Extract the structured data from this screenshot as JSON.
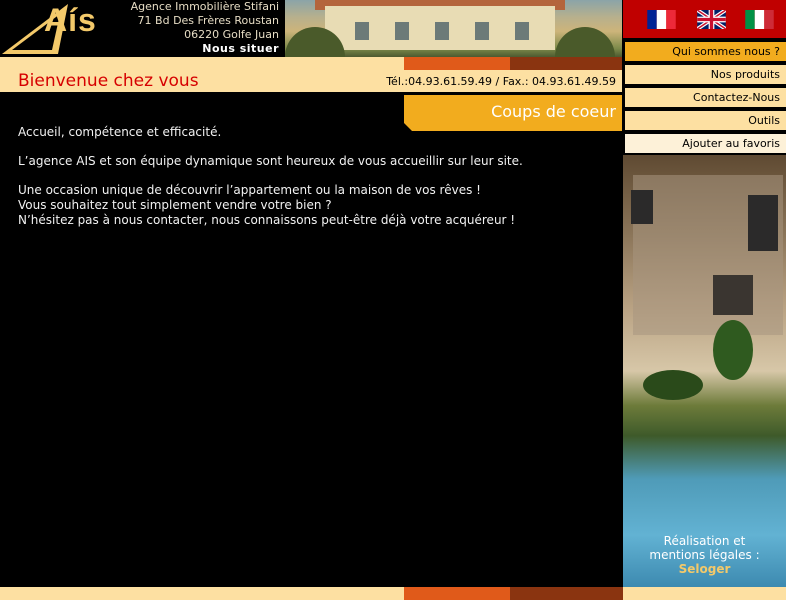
{
  "brand": {
    "logo_text": "Aís"
  },
  "address": {
    "line1": "Agence Immobilière Stifani",
    "line2": "71 Bd Des Frères Roustan",
    "line3": "06220 Golfe Juan",
    "locate_link": "Nous situer"
  },
  "header": {
    "title": "Bienvenue chez vous",
    "phone": "Tél.:04.93.61.59.49 / Fax.: 04.93.61.49.59",
    "tab_label": "Coups de coeur"
  },
  "languages": [
    {
      "name": "french-flag-icon"
    },
    {
      "name": "uk-flag-icon"
    },
    {
      "name": "italian-flag-icon"
    }
  ],
  "menu": {
    "items": [
      {
        "label": "Qui sommes nous ?"
      },
      {
        "label": "Nos produits"
      },
      {
        "label": "Contactez-Nous"
      },
      {
        "label": "Outils"
      },
      {
        "label": "Ajouter au favoris"
      }
    ]
  },
  "content": {
    "p1": "Accueil, compétence et efficacité.",
    "p2": "L’agence AIS et son équipe dynamique sont heureux de vous accueillir sur leur site.",
    "p3_l1": "Une occasion unique de découvrir l’appartement ou la maison de vos rêves !",
    "p3_l2": "Vous souhaitez tout simplement vendre votre bien ?",
    "p3_l3": "N’hésitez pas à nous contacter, nous connaissons peut-être déjà votre acquéreur !"
  },
  "credits": {
    "line1": "Réalisation et",
    "line2": "mentions légales :",
    "brand": "Seloger"
  },
  "colors": {
    "accent_red": "#d60000",
    "band_yellow": "#fde0a2",
    "tab_orange": "#f2ac1e",
    "band_orange": "#e05a1a",
    "band_brown": "#8a3410",
    "flag_bar": "#c00000"
  }
}
